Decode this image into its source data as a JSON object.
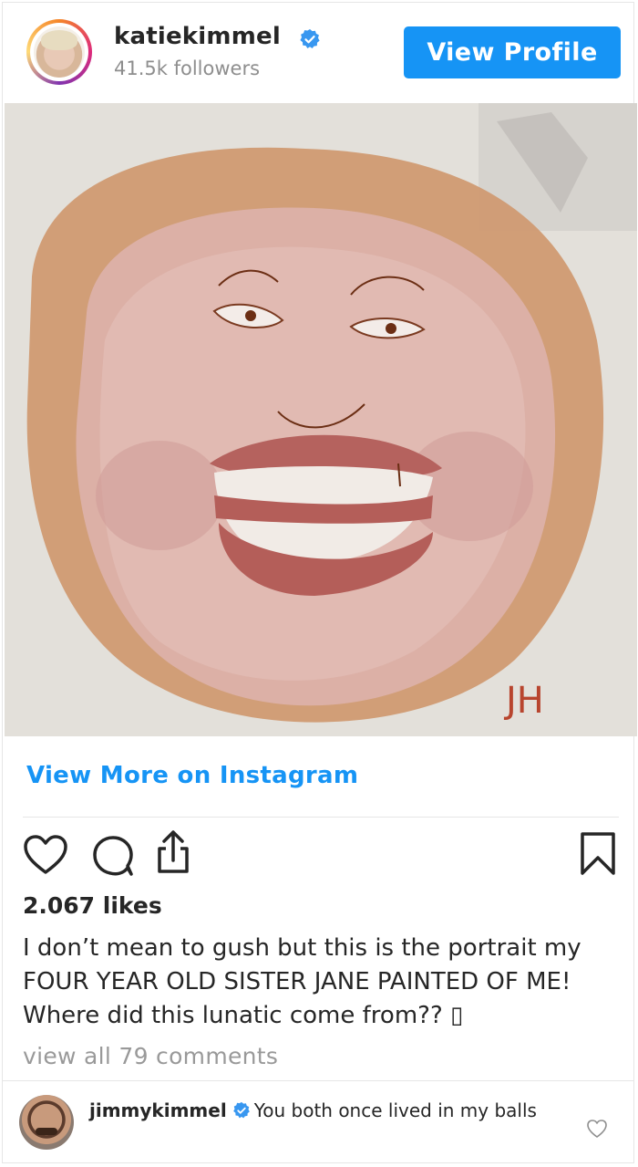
{
  "header": {
    "username": "katiekimmel",
    "followers": "41.5k followers",
    "view_profile_label": "View Profile"
  },
  "photo": {
    "signature": "JH"
  },
  "more_link": "View More on Instagram",
  "actions": {
    "like_icon": "heart-icon",
    "comment_icon": "comment-icon",
    "share_icon": "share-icon",
    "save_icon": "bookmark-icon"
  },
  "likes": "2.067 likes",
  "caption": "I don’t mean to gush but this is the portrait my FOUR YEAR OLD SISTER JANE PAINTED OF ME! Where did this lunatic come from?? ▯",
  "view_all_comments": "view all 79 comments",
  "comment": {
    "user": "jimmykimmel",
    "text": "You both once lived in my balls"
  },
  "colors": {
    "accent": "#1694f5",
    "text": "#262626",
    "muted": "#8e8e8e"
  }
}
